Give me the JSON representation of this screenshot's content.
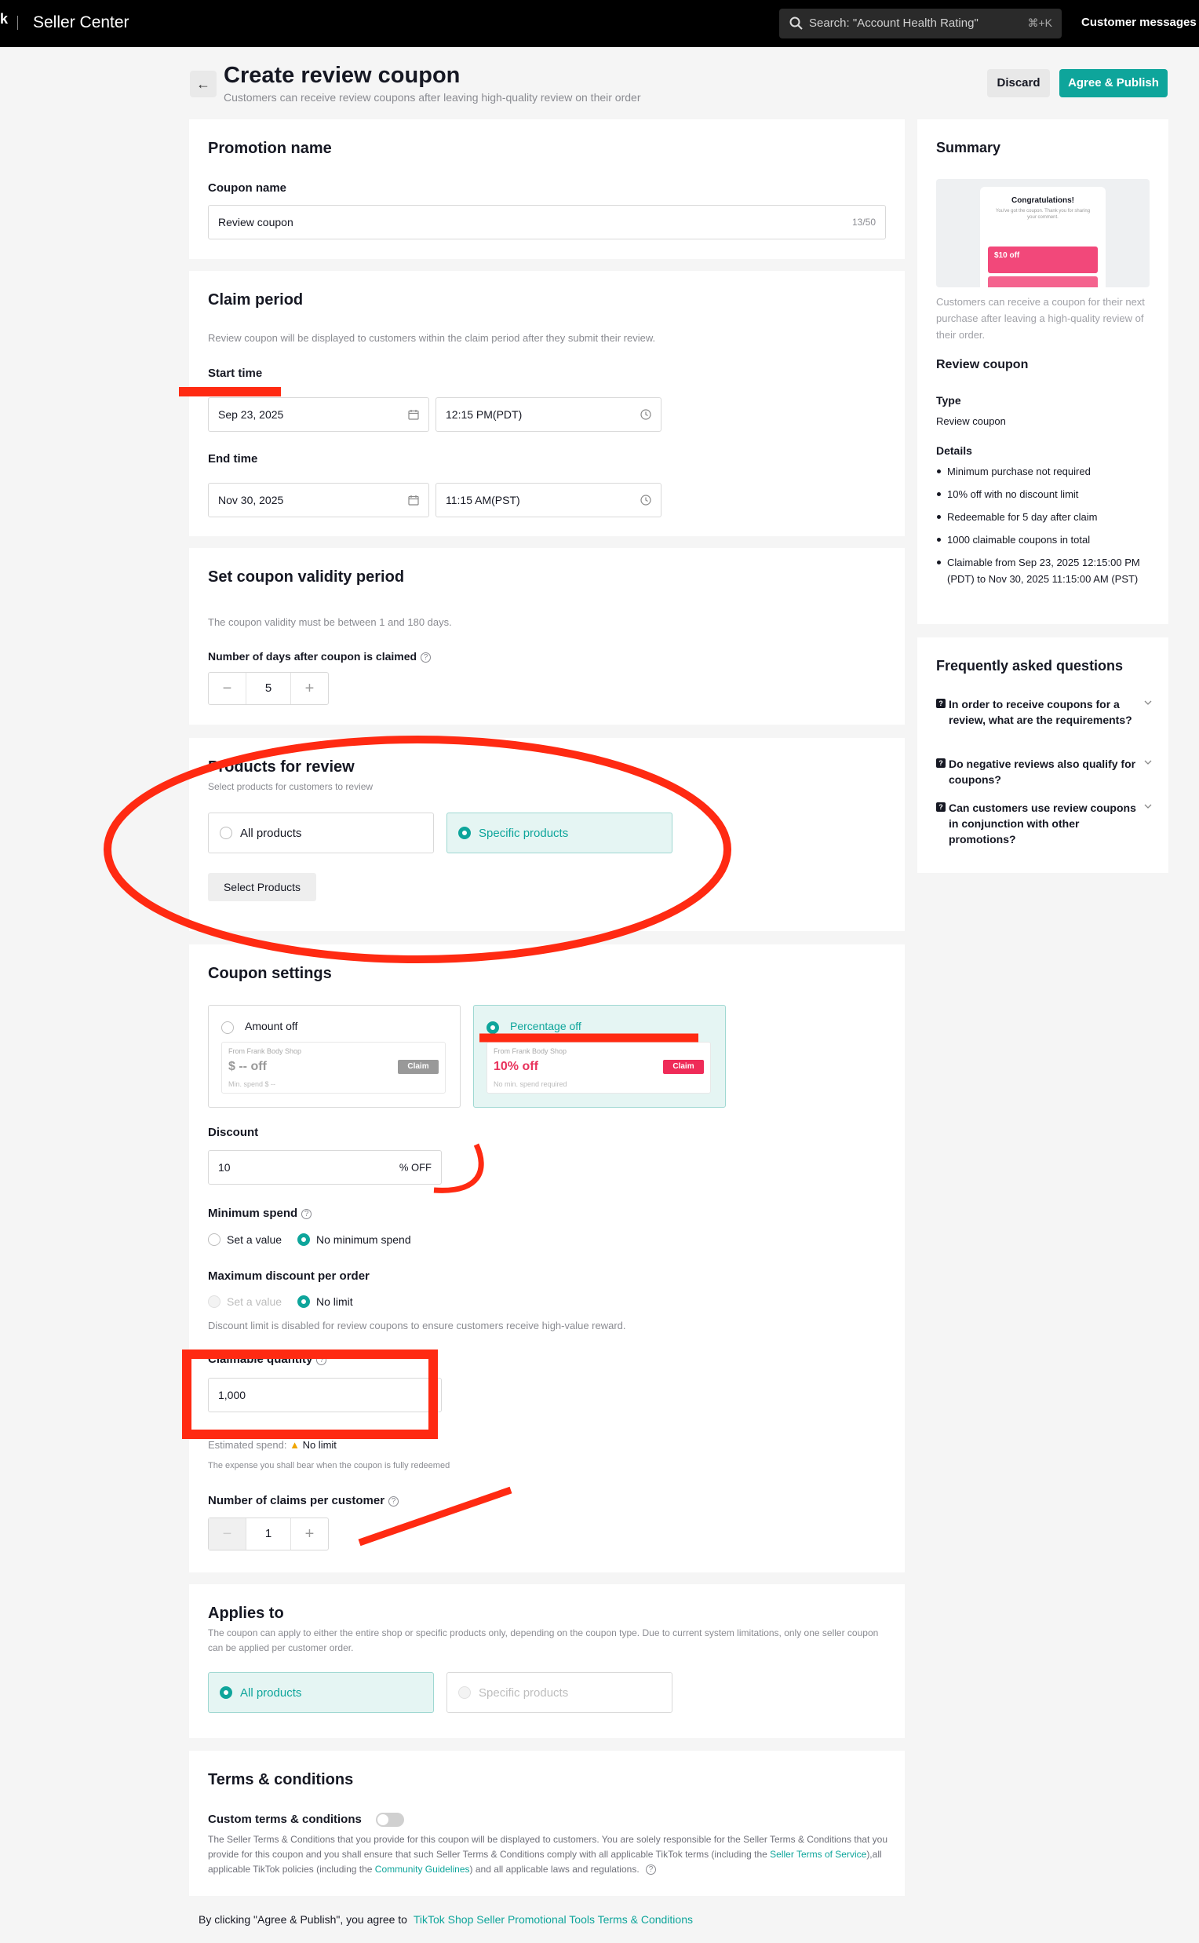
{
  "topbar": {
    "logo_glyph": "k",
    "brand": "Seller Center",
    "search_text": "Search: \"Account Health Rating\"",
    "search_shortcut": "⌘+K",
    "customer_messages": "Customer messages"
  },
  "header": {
    "title": "Create review coupon",
    "subtitle": "Customers can receive review coupons after leaving high-quality review on their order",
    "discard": "Discard",
    "publish": "Agree & Publish"
  },
  "promotion": {
    "title": "Promotion name",
    "coupon_name_label": "Coupon name",
    "coupon_name_value": "Review coupon",
    "char_count": "13/50"
  },
  "claim": {
    "title": "Claim period",
    "description": "Review coupon will be displayed to customers within the claim period after they submit their review.",
    "start_label": "Start time",
    "start_date": "Sep 23, 2025",
    "start_time": "12:15 PM(PDT)",
    "end_label": "End time",
    "end_date": "Nov 30, 2025",
    "end_time": "11:15 AM(PST)"
  },
  "validity": {
    "title": "Set coupon validity period",
    "description": "The coupon validity must be between 1 and 180 days.",
    "days_label": "Number of days after coupon is claimed",
    "days_value": "5"
  },
  "products": {
    "title": "Products for review",
    "description": "Select products for customers to review",
    "option_all": "All products",
    "option_specific": "Specific products",
    "select_button": "Select Products"
  },
  "coupon_settings": {
    "title": "Coupon settings",
    "type_amount": {
      "label": "Amount off",
      "shop": "From Frank Body Shop",
      "amount": "$ -- off",
      "min": "Min. spend $ --",
      "claim": "Claim"
    },
    "type_percent": {
      "label": "Percentage off",
      "shop": "From Frank Body Shop",
      "amount": "10% off",
      "min": "No min. spend required",
      "claim": "Claim"
    },
    "discount_label": "Discount",
    "discount_value": "10",
    "discount_suffix": "% OFF",
    "min_spend_label": "Minimum spend",
    "min_spend_set": "Set a value",
    "min_spend_none": "No minimum spend",
    "max_discount_label": "Maximum discount per order",
    "max_discount_set": "Set a value",
    "max_discount_none": "No limit",
    "max_discount_note": "Discount limit is disabled for review coupons to ensure customers receive high-value reward.",
    "claimable_label": "Claimable quantity",
    "claimable_value": "1,000",
    "estimated_label": "Estimated spend:",
    "estimated_value": "No limit",
    "estimated_note": "The expense you shall bear when the coupon is fully redeemed",
    "claims_per_customer_label": "Number of claims per customer",
    "claims_per_customer_value": "1"
  },
  "applies": {
    "title": "Applies to",
    "description": "The coupon can apply to either the entire shop or specific products only, depending on the coupon type. Due to current system limitations, only one seller coupon can be applied per customer order.",
    "option_all": "All products",
    "option_specific": "Specific products"
  },
  "terms": {
    "title": "Terms & conditions",
    "custom_label": "Custom terms & conditions",
    "text_1": "The Seller Terms & Conditions that you provide for this coupon will be displayed to customers. You are solely responsible for the Seller Terms & Conditions that you provide for this coupon and you shall ensure that such Seller Terms & Conditions comply with all applicable TikTok terms (including the",
    "link_1": "Seller Terms of Service",
    "text_2": "),all applicable TikTok policies (including the",
    "link_2": "Community Guidelines",
    "text_3": ") and all applicable laws and regulations."
  },
  "footer": {
    "text": "By clicking \"Agree & Publish\", you agree to",
    "link": "TikTok Shop Seller Promotional Tools Terms & Conditions"
  },
  "summary": {
    "title": "Summary",
    "preview_congrats": "Congratulations!",
    "preview_sub": "You've got the coupon. Thank you for sharing your comment.",
    "preview_amount": "$10 off",
    "caption": "Customers can receive a coupon for their next purchase after leaving a high-quality review of their order.",
    "coupon_heading": "Review coupon",
    "type_label": "Type",
    "type_value": "Review coupon",
    "details_label": "Details",
    "details": [
      "Minimum purchase not required",
      "10% off with no discount limit",
      "Redeemable for 5 day after claim",
      "1000 claimable coupons in total",
      "Claimable from Sep 23, 2025 12:15:00 PM (PDT) to Nov 30, 2025 11:15:00 AM (PST)"
    ]
  },
  "faq": {
    "title": "Frequently asked questions",
    "items": [
      "In order to receive coupons for a review, what are the requirements?",
      "Do negative reviews also qualify for coupons?",
      "Can customers use review coupons in conjunction with other promotions?"
    ]
  },
  "colors": {
    "accent": "#0ea59b",
    "annotation": "#ff2a12",
    "coupon_pink": "#ef2b58"
  }
}
